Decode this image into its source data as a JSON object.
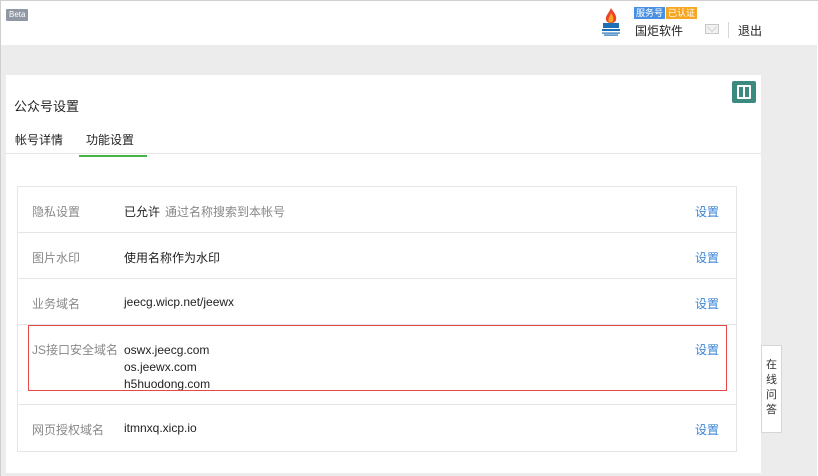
{
  "header": {
    "beta": "Beta",
    "account_type_tag": "服务号",
    "verified_tag": "已认证",
    "account_name": "国炬软件",
    "logout": "退出"
  },
  "page": {
    "title": "公众号设置",
    "tabs": [
      {
        "label": "帐号详情",
        "active": false
      },
      {
        "label": "功能设置",
        "active": true
      }
    ]
  },
  "settings": [
    {
      "label": "隐私设置",
      "value": "已允许",
      "note": "通过名称搜索到本帐号",
      "action": "设置"
    },
    {
      "label": "图片水印",
      "value": "使用名称作为水印",
      "action": "设置"
    },
    {
      "label": "业务域名",
      "value": "jeecg.wicp.net/jeewx",
      "action": "设置"
    },
    {
      "label": "JS接口安全域名",
      "values": [
        "oswx.jeecg.com",
        "os.jeewx.com",
        "h5huodong.com"
      ],
      "action": "设置"
    },
    {
      "label": "网页授权域名",
      "value": "itmnxq.xicp.io",
      "action": "设置"
    }
  ],
  "side_chat": {
    "chars": [
      "在",
      "线",
      "问",
      "答"
    ]
  },
  "colors": {
    "accent_green": "#44b549",
    "link_blue": "#3a84d7",
    "highlight_red": "#e5494a"
  }
}
